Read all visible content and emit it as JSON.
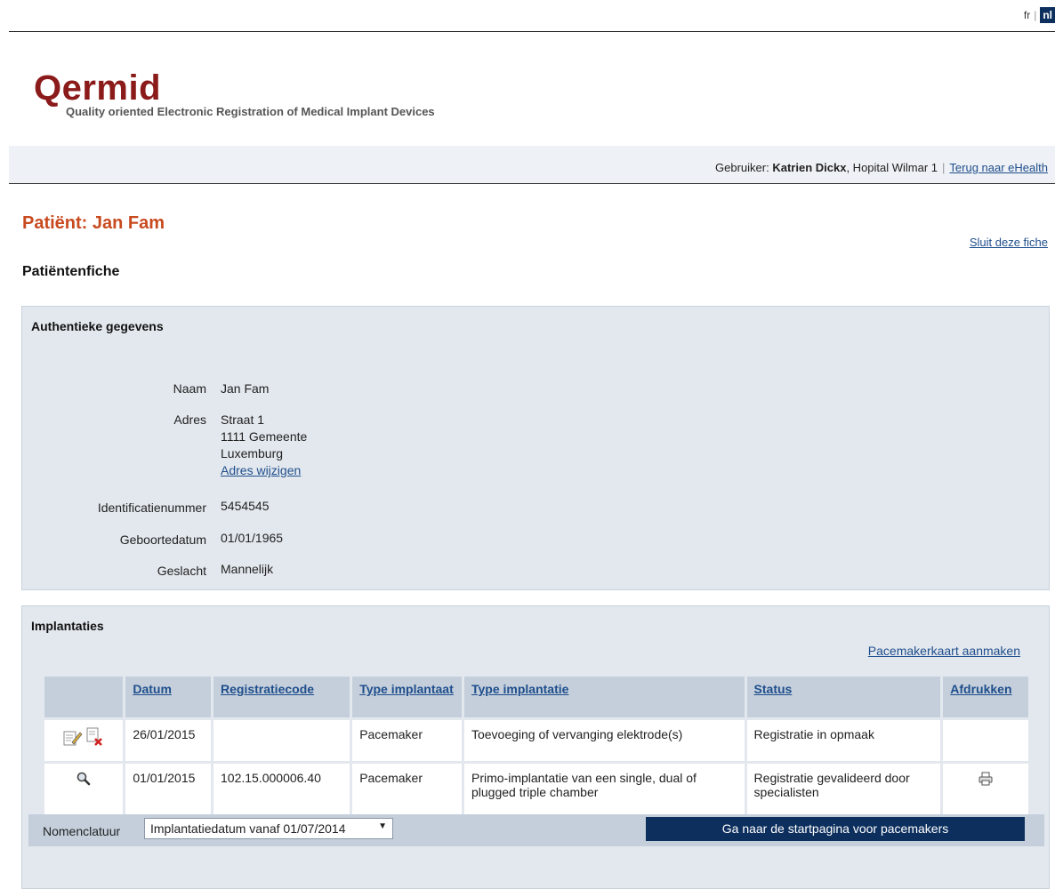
{
  "lang": {
    "fr": "fr",
    "nl": "nl"
  },
  "logo": {
    "title": "Qermid",
    "subtitle": "Quality oriented Electronic Registration of Medical Implant Devices"
  },
  "userbar": {
    "user_label": "Gebruiker:",
    "user_name": "Katrien Dickx",
    "hospital": ", Hopital Wilmar 1",
    "back_link": "Terug naar eHealth"
  },
  "patient": {
    "title": "Patiënt: Jan Fam",
    "close_link": "Sluit deze fiche",
    "fiche_title": "Patiëntenfiche"
  },
  "auth": {
    "title": "Authentieke gegevens",
    "naam_label": "Naam",
    "naam": "Jan Fam",
    "adres_label": "Adres",
    "adres_line1": "Straat 1",
    "adres_line2": "1111 Gemeente",
    "adres_line3": "Luxemburg",
    "adres_link": "Adres wijzigen",
    "id_label": "Identificatienummer",
    "id": "5454545",
    "geboorte_label": "Geboortedatum",
    "geboorte": "01/01/1965",
    "geslacht_label": "Geslacht",
    "geslacht": "Mannelijk"
  },
  "impl": {
    "title": "Implantaties",
    "pacemaker_link": "Pacemakerkaart aanmaken",
    "columns": {
      "datum": "Datum",
      "code": "Registratiecode",
      "type_impl": "Type implantaat",
      "type_implantatie": "Type implantatie",
      "status": "Status",
      "afdrukken": "Afdrukken"
    },
    "rows": [
      {
        "datum": "26/01/2015",
        "code": "",
        "type_impl": "Pacemaker",
        "type_implantatie": "Toevoeging of vervanging elektrode(s)",
        "status": "Registratie in opmaak"
      },
      {
        "datum": "01/01/2015",
        "code": "102.15.000006.40",
        "type_impl": "Pacemaker",
        "type_implantatie": "Primo-implantatie van een single, dual of plugged triple chamber",
        "status": "Registratie gevalideerd door specialisten"
      }
    ]
  },
  "bottom": {
    "nom_label": "Nomenclatuur",
    "select_value": "Implantatiedatum vanaf 01/07/2014",
    "go_button": "Ga naar de startpagina voor pacemakers"
  },
  "colors": {
    "brand": "#8b1a1a",
    "patient_title": "#c84a1f",
    "link": "#1f4e8c",
    "panel": "#e3e8ee",
    "header": "#c4cfdb",
    "button": "#0c2f5e"
  }
}
